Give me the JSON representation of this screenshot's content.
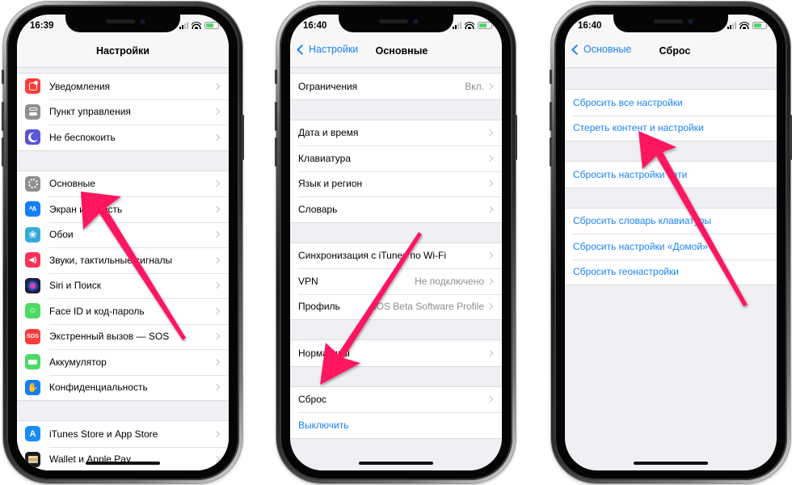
{
  "phones": [
    {
      "status_time": "16:39",
      "nav_title": "Настройки",
      "groups": [
        [
          {
            "label": "Уведомления",
            "icon": "notifications-icon",
            "icon_color": "#fc3d39"
          },
          {
            "label": "Пункт управления",
            "icon": "control-center-icon",
            "icon_color": "#8e8e93"
          },
          {
            "label": "Не беспокоить",
            "icon": "moon-icon",
            "icon_color": "#5856d6"
          }
        ],
        [
          {
            "label": "Основные",
            "icon": "gear-icon",
            "icon_color": "#8e8e93"
          },
          {
            "label": "Экран и яркость",
            "icon": "display-brightness-icon",
            "icon_color": "#147efb"
          },
          {
            "label": "Обои",
            "icon": "wallpaper-flower-icon",
            "icon_color": "#34aadc"
          },
          {
            "label": "Звуки, тактильные сигналы",
            "icon": "speaker-icon",
            "icon_color": "#fc3158"
          },
          {
            "label": "Siri и Поиск",
            "icon": "siri-icon",
            "icon_color": "#1c1c3a"
          },
          {
            "label": "Face ID и код-пароль",
            "icon": "face-id-icon",
            "icon_color": "#4cd964"
          },
          {
            "label": "Экстренный вызов — SOS",
            "icon": "sos-icon",
            "icon_color": "#fc3d39",
            "icon_text": "SOS"
          },
          {
            "label": "Аккумулятор",
            "icon": "battery-icon",
            "icon_color": "#4cd964"
          },
          {
            "label": "Конфиденциальность",
            "icon": "hand-icon",
            "icon_color": "#147efb"
          }
        ],
        [
          {
            "label": "iTunes Store и App Store",
            "icon": "app-store-icon",
            "icon_color": "#1a8cf5"
          },
          {
            "label": "Wallet и Apple Pay",
            "icon": "wallet-icon",
            "icon_color": "#1c1c1e"
          }
        ]
      ]
    },
    {
      "status_time": "16:40",
      "nav_back": "Настройки",
      "nav_title": "Основные",
      "groups": [
        [
          {
            "label": "Ограничения",
            "value": "Вкл."
          }
        ],
        [
          {
            "label": "Дата и время"
          },
          {
            "label": "Клавиатура"
          },
          {
            "label": "Язык и регион"
          },
          {
            "label": "Словарь"
          }
        ],
        [
          {
            "label": "Синхронизация с iTunes по Wi-Fi"
          },
          {
            "label": "VPN",
            "value": "Не подключено"
          },
          {
            "label": "Профиль",
            "value": "iOS Beta Software Profile"
          }
        ],
        [
          {
            "label": "Нормативы"
          }
        ],
        [
          {
            "label": "Сброс"
          },
          {
            "label": "Выключить",
            "blue": true,
            "no_chevron": true
          }
        ]
      ]
    },
    {
      "status_time": "16:40",
      "nav_back": "Основные",
      "nav_title": "Сброс",
      "groups": [
        [
          {
            "label": "Сбросить все настройки"
          },
          {
            "label": "Стереть контент и настройки"
          }
        ],
        [
          {
            "label": "Сбросить настройки сети"
          }
        ],
        [
          {
            "label": "Сбросить словарь клавиатуры"
          },
          {
            "label": "Сбросить настройки «Домой»"
          },
          {
            "label": "Сбросить геонастройки"
          }
        ]
      ]
    }
  ],
  "colors": {
    "accent_blue": "#1a82fb",
    "annotation_arrow": "#fe1461",
    "grouped_bg": "#efeff4"
  },
  "annotations": [
    {
      "phone": 1,
      "points_to": "Основные"
    },
    {
      "phone": 2,
      "points_to": "Сброс"
    },
    {
      "phone": 3,
      "points_to": "Стереть контент и настройки"
    }
  ]
}
